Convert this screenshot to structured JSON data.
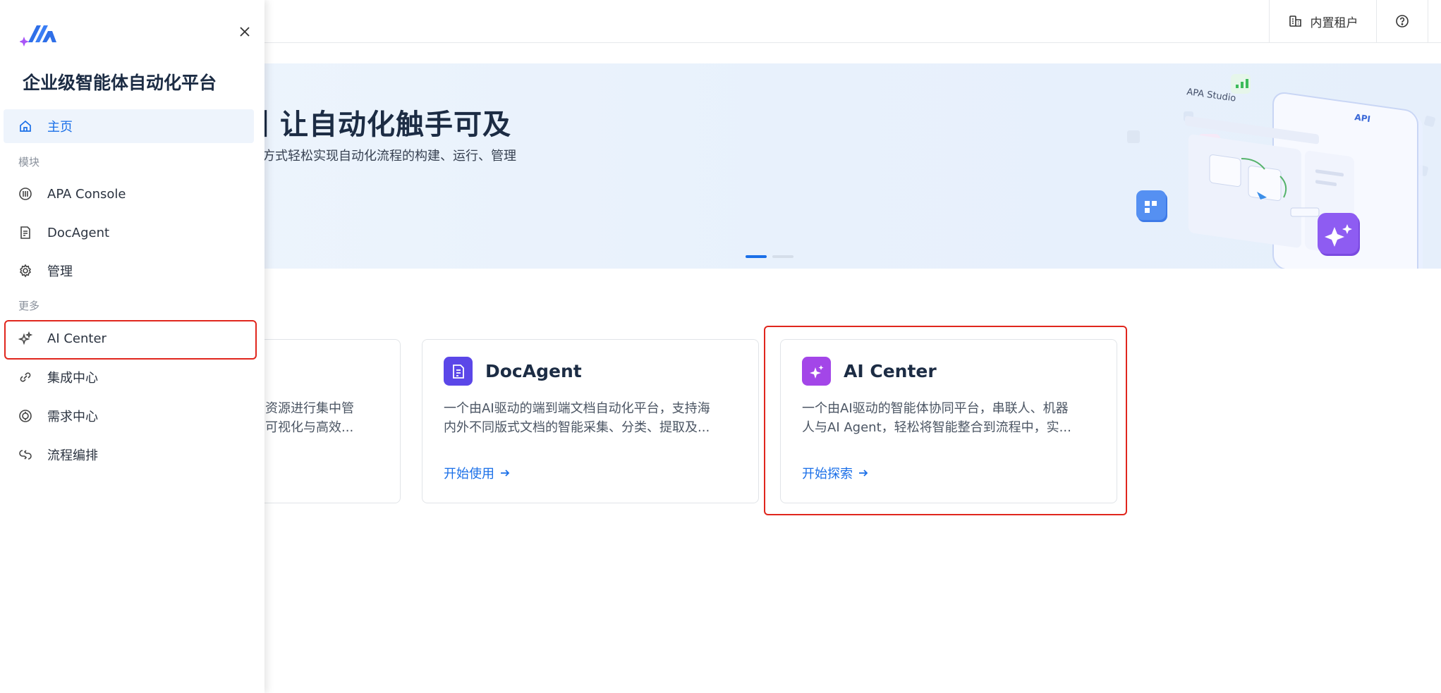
{
  "header": {
    "tenant_label": "内置租户"
  },
  "banner": {
    "title": "丨让自动化触手可及",
    "subtitle": "方式轻松实现自动化流程的构建、运行、管理",
    "illustration_label_studio": "APA Studio",
    "illustration_label_api": "API",
    "slides": {
      "count": 2,
      "active_index": 0
    }
  },
  "sidebar": {
    "brand": "企业级智能体自动化平台",
    "home": "主页",
    "section_modules": "模块",
    "modules": [
      {
        "label": "APA Console",
        "icon": "console-icon"
      },
      {
        "label": "DocAgent",
        "icon": "document-icon"
      },
      {
        "label": "管理",
        "icon": "gear-icon"
      }
    ],
    "section_more": "更多",
    "more": [
      {
        "label": "AI Center",
        "icon": "sparkle-icon"
      },
      {
        "label": "集成中心",
        "icon": "link-icon"
      },
      {
        "label": "需求中心",
        "icon": "requirement-icon"
      },
      {
        "label": "流程编排",
        "icon": "flow-icon"
      }
    ]
  },
  "cards": [
    {
      "title": "",
      "desc_line1": "资源进行集中管",
      "desc_line2": "可视化与高效..."
    },
    {
      "title": "DocAgent",
      "desc_line1": "一个由AI驱动的端到端文档自动化平台，支持海",
      "desc_line2": "内外不同版式文档的智能采集、分类、提取及...",
      "link": "开始使用",
      "icon_color": "#5b47e8"
    },
    {
      "title": "AI Center",
      "desc_line1": "一个由AI驱动的智能体协同平台，串联人、机器",
      "desc_line2": "人与AI Agent，轻松将智能整合到流程中，实...",
      "link": "开始探索",
      "icon_color": "#a346e8"
    }
  ],
  "colors": {
    "accent": "#1a6fe8",
    "highlight": "#e0261d"
  }
}
